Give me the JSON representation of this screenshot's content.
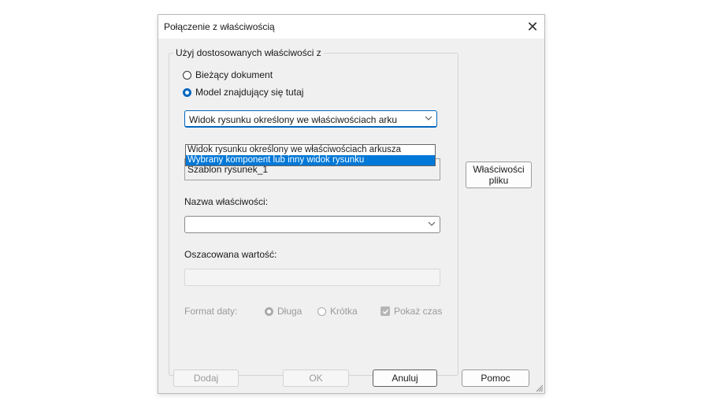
{
  "dialog": {
    "title": "Połączenie z właściwością",
    "close_symbol": "✕"
  },
  "group": {
    "legend": "Użyj dostosowanych właściwości z",
    "radio_current": "Bieżący dokument",
    "radio_model": "Model znajdujący się tutaj",
    "source_combo_value": "Widok rysunku określony we właściwościach arku",
    "dropdown_options": [
      "Widok rysunku określony we właściwościach arkusza",
      "Wybrany komponent lub inny widok rysunku"
    ],
    "template_value": "Szablon rysunek_1",
    "property_name_label": "Nazwa właściwości:",
    "property_name_value": "",
    "evaluated_label": "Oszacowana wartość:",
    "evaluated_value": "",
    "date_format_label": "Format daty:",
    "date_long": "Długa",
    "date_short": "Krótka",
    "show_time": "Pokaż czas"
  },
  "buttons": {
    "file_props": "Właściwości pliku",
    "add": "Dodaj",
    "ok": "OK",
    "cancel": "Anuluj",
    "help": "Pomoc"
  },
  "colors": {
    "accent": "#0067c0",
    "selection": "#0078d7"
  }
}
